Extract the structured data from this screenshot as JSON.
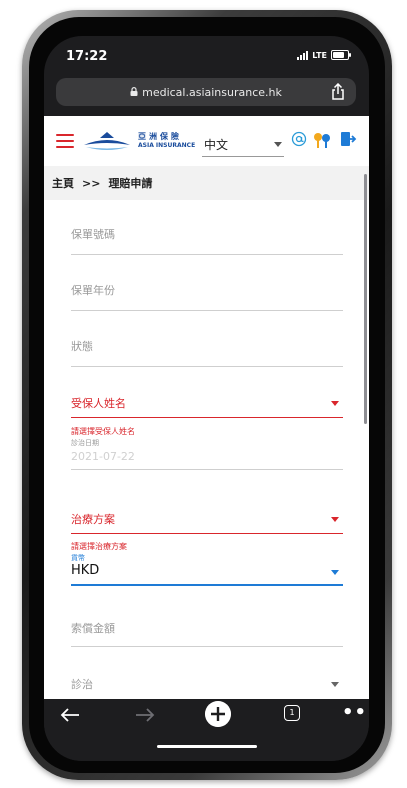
{
  "status_bar": {
    "time": "17:22",
    "network": "LTE"
  },
  "browser": {
    "url": "medical.asiainsurance.hk",
    "tabs_count": "1"
  },
  "header": {
    "logo_cn": "亞洲保險",
    "logo_en": "ASIA INSURANCE",
    "language": "中文"
  },
  "breadcrumb": {
    "home": "主頁",
    "separator": ">>",
    "current": "理賠申請"
  },
  "form": {
    "policy_no_label": "保單號碼",
    "policy_year_label": "保單年份",
    "status_label": "狀態",
    "insured_name_label": "受保人姓名",
    "insured_name_error": "請選擇受保人姓名",
    "treatment_date_label": "診治日期",
    "treatment_date_value": "2021-07-22",
    "treatment_plan_label": "治療方案",
    "treatment_plan_error": "請選擇治療方案",
    "currency_label": "貨幣",
    "currency_value": "HKD",
    "claim_amount_label": "索償金額",
    "diagnosis_label": "診治"
  },
  "colors": {
    "accent_red": "#d9262c",
    "accent_blue": "#1e7bd6",
    "brand_blue": "#1a4c9c"
  }
}
